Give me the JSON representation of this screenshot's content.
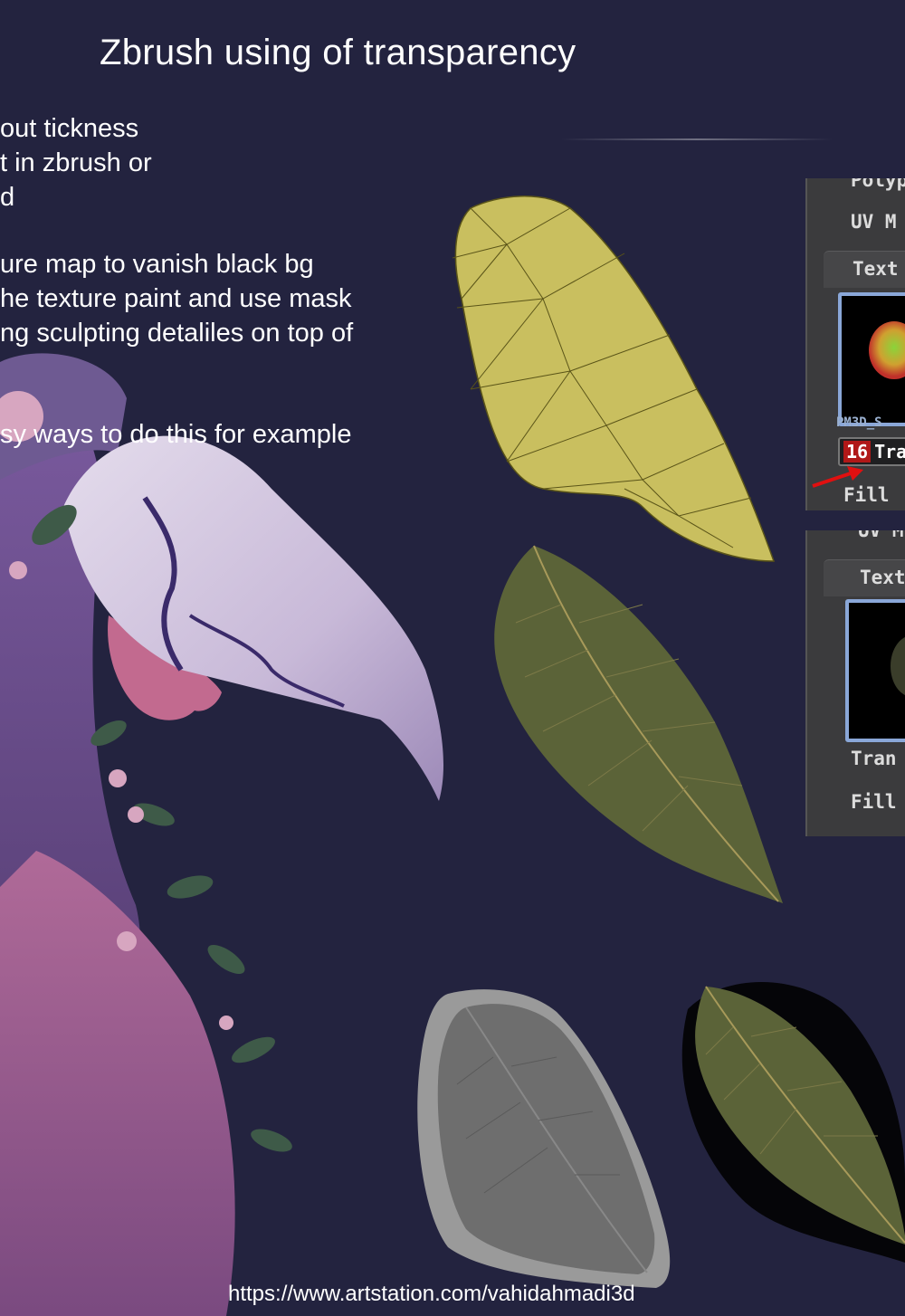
{
  "title": "Zbrush using of transparency",
  "body_lines": [
    "out tickness",
    "t in zbrush or",
    "d",
    "ure map to vanish black bg",
    "he texture paint and use mask",
    "ng sculpting detaliles on top of",
    "sy ways to do this for example"
  ],
  "footer_url": "https://www.artstation.com/vahidahmadi3d",
  "panel_top": {
    "header_partial": "Polyp",
    "uv_label": "UV M",
    "texture_label": "Text",
    "thumb_caption": "PM3D_S",
    "badge_number": "16",
    "badge_text": "Tra",
    "fill_label": "Fill"
  },
  "panel_bottom": {
    "uv_label": "UV M",
    "texture_label": "Text",
    "transparency_label": "Tran",
    "fill_label": "Fill"
  },
  "colors": {
    "background": "#23233f",
    "mesh_yellow": "#c9bf5f",
    "leaf_green": "#5b6338",
    "panel_grey": "#3b3b3d",
    "thumb_border": "#8aa7d8",
    "badge_red": "#b01818"
  }
}
